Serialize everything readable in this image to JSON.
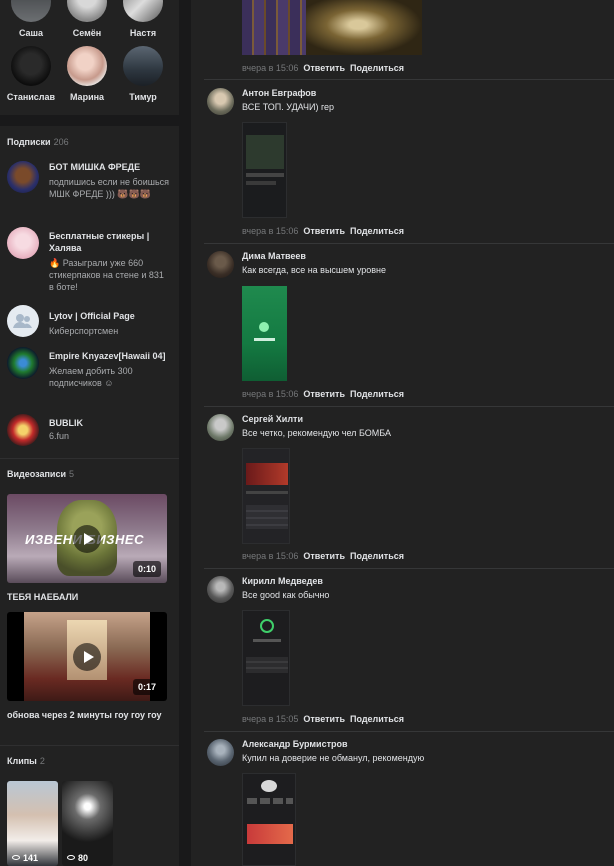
{
  "friends": [
    {
      "name": "Саша"
    },
    {
      "name": "Семён"
    },
    {
      "name": "Настя"
    },
    {
      "name": "Станислав"
    },
    {
      "name": "Марина"
    },
    {
      "name": "Тимур"
    }
  ],
  "subscriptions": {
    "title": "Подписки",
    "count": "206",
    "items": [
      {
        "name": "БОТ МИШКА ФРЕДЕ",
        "desc": "подпишись если не боишься МШК ФРЕДЕ ))) 🐻🐻🐻"
      },
      {
        "name": "Бесплатные стикеры | Халява",
        "desc": "🔥 Разыграли уже 660 стикерпаков на стене и 831 в боте!"
      },
      {
        "name": "Lytov | Official Page",
        "desc": "Киберспортсмен"
      },
      {
        "name": "Empire Knyazev[Hawaii 04]",
        "desc": "Желаем добить 300 подписчиков ☺"
      },
      {
        "name": "BUBLIK",
        "desc": "6.fun"
      }
    ]
  },
  "videos": {
    "title": "Видеозаписи",
    "count": "5",
    "items": [
      {
        "title": "ТЕБЯ НАЕБАЛИ",
        "duration": "0:10",
        "overlay": "ИЗВЕНИ БИЗНЕС"
      },
      {
        "title": "обнова через 2 минуты гоу гоу гоу",
        "duration": "0:17"
      }
    ]
  },
  "clips": {
    "title": "Клипы",
    "count": "2",
    "items": [
      {
        "views": "141"
      },
      {
        "views": "80"
      }
    ]
  },
  "comments": [
    {
      "name": "",
      "text": "",
      "time": "вчера в 15:06"
    },
    {
      "name": "Антон Евграфов",
      "text": "ВСЕ ТОП. УДАЧИ) гер",
      "time": "вчера в 15:06"
    },
    {
      "name": "Дима Матвеев",
      "text": "Как всегда, все на высшем уровне",
      "time": "вчера в 15:06"
    },
    {
      "name": "Сергей Хилти",
      "text": "Все четко, рекомендую чел БОМБА",
      "time": "вчера в 15:06"
    },
    {
      "name": "Кирилл Медведев",
      "text": "Все good как обычно",
      "time": "вчера в 15:05"
    },
    {
      "name": "Александр Бурмистров",
      "text": "Купил на доверие не обманул, рекомендую",
      "time": ""
    }
  ],
  "actions": {
    "reply": "Ответить",
    "share": "Поделиться"
  },
  "colors": {
    "page_bg": "#19191a",
    "card_bg": "#222222",
    "text": "#e1e3e6",
    "muted": "#76787a"
  }
}
